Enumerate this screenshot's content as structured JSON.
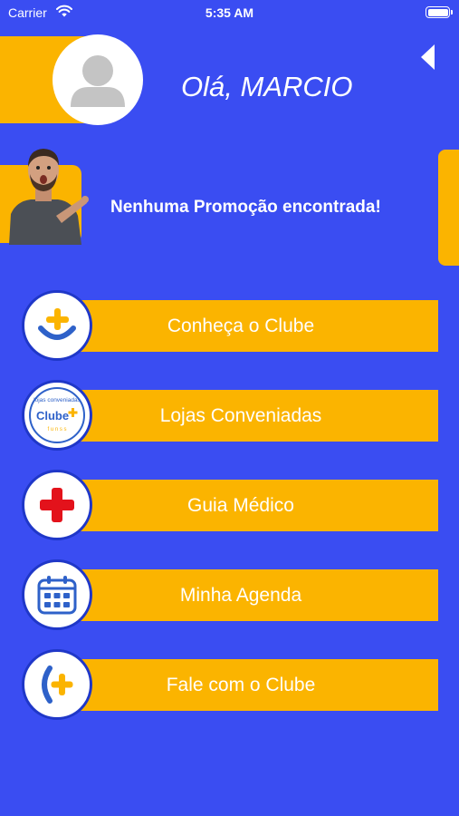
{
  "status": {
    "carrier": "Carrier",
    "time": "5:35 AM"
  },
  "header": {
    "greeting": "Olá, MARCIO"
  },
  "promo": {
    "message": "Nenhuma Promoção encontrada!"
  },
  "menu": [
    {
      "label": "Conheça  o Clube",
      "icon": "clube-plus-smile-icon"
    },
    {
      "label": "Lojas Conveniadas",
      "icon": "lojas-conveniadas-badge-icon"
    },
    {
      "label": "Guia Médico",
      "icon": "red-cross-icon"
    },
    {
      "label": "Minha Agenda",
      "icon": "calendar-icon"
    },
    {
      "label": "Fale com o Clube",
      "icon": "phone-plus-icon"
    }
  ],
  "badge": {
    "top_text": "lojas conveniadas",
    "logo_text": "Clube",
    "bottom_text": "f u n s s"
  },
  "colors": {
    "background": "#3a4df2",
    "accent": "#fbb400",
    "icon_border": "#1f37c8",
    "blue_icon": "#2e61c9",
    "red_cross": "#e3121b"
  }
}
